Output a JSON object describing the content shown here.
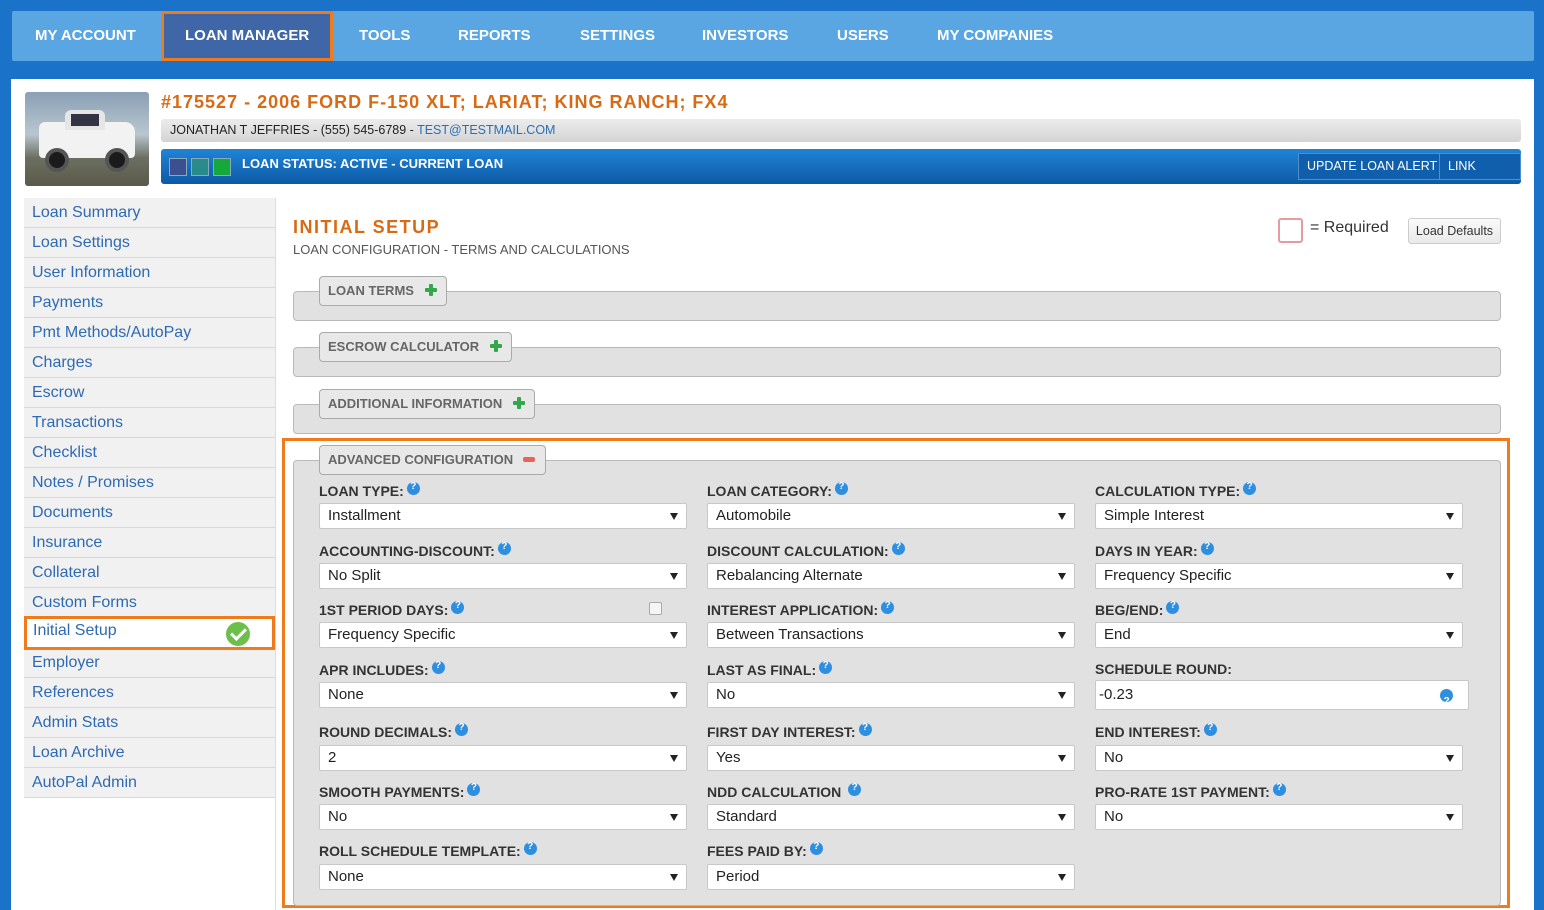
{
  "nav": {
    "items": [
      "MY ACCOUNT",
      "LOAN MANAGER",
      "TOOLS",
      "REPORTS",
      "SETTINGS",
      "INVESTORS",
      "USERS",
      "MY COMPANIES"
    ],
    "active_index": 1,
    "accent_color": "#ef7b1d"
  },
  "loan": {
    "title": "#175527 - 2006 FORD F-150 XLT; LARIAT; KING RANCH; FX4",
    "contact": "JONATHAN T JEFFRIES - (555) 545-6789 - ",
    "email": "TEST@TESTMAIL.COM",
    "status": "LOAN STATUS: ACTIVE - CURRENT LOAN",
    "status_colors": [
      "#3c4f8f",
      "#2a8c8a",
      "#15a83a"
    ],
    "buttons": {
      "alert": "UPDATE LOAN ALERT",
      "link": "LINK LOAN"
    }
  },
  "sidebar": {
    "items": [
      "Loan Summary",
      "Loan Settings",
      "User Information",
      "Payments",
      "Pmt Methods/AutoPay",
      "Charges",
      "Escrow",
      "Transactions",
      "Checklist",
      "Notes / Promises",
      "Documents",
      "Insurance",
      "Collateral",
      "Custom Forms",
      "Initial Setup",
      "Employer",
      "References",
      "Admin Stats",
      "Loan Archive",
      "AutoPal Admin"
    ],
    "active": "Initial Setup"
  },
  "page": {
    "title": "INITIAL SETUP",
    "subtitle": "LOAN CONFIGURATION - TERMS AND CALCULATIONS",
    "required_text": "= Required",
    "load_defaults": "Load Defaults"
  },
  "sections": {
    "loan_terms": "LOAN TERMS",
    "escrow": "ESCROW CALCULATOR",
    "additional": "ADDITIONAL INFORMATION",
    "advanced": "ADVANCED CONFIGURATION"
  },
  "fields": {
    "loan_type": {
      "label": "LOAN TYPE:",
      "value": "Installment"
    },
    "loan_category": {
      "label": "LOAN CATEGORY:",
      "value": "Automobile"
    },
    "calculation_type": {
      "label": "CALCULATION TYPE:",
      "value": "Simple Interest"
    },
    "accounting_discount": {
      "label": "ACCOUNTING-DISCOUNT:",
      "value": "No Split"
    },
    "discount_calculation": {
      "label": "DISCOUNT CALCULATION:",
      "value": "Rebalancing Alternate"
    },
    "days_in_year": {
      "label": "DAYS IN YEAR:",
      "value": "Frequency Specific"
    },
    "first_period_days": {
      "label": "1ST PERIOD DAYS:",
      "value": "Frequency Specific"
    },
    "interest_application": {
      "label": "INTEREST APPLICATION:",
      "value": "Between Transactions"
    },
    "beg_end": {
      "label": "BEG/END:",
      "value": "End"
    },
    "apr_includes": {
      "label": "APR INCLUDES:",
      "value": "None"
    },
    "last_as_final": {
      "label": "LAST AS FINAL:",
      "value": "No"
    },
    "schedule_round": {
      "label": "SCHEDULE ROUND:",
      "value": "-0.23"
    },
    "round_decimals": {
      "label": "ROUND DECIMALS:",
      "value": "2"
    },
    "first_day_interest": {
      "label": "FIRST DAY INTEREST:",
      "value": "Yes"
    },
    "end_interest": {
      "label": "END INTEREST:",
      "value": "No"
    },
    "smooth_payments": {
      "label": "SMOOTH PAYMENTS:",
      "value": "No"
    },
    "ndd_calculation": {
      "label": "NDD CALCULATION",
      "value": "Standard"
    },
    "prorate_first_payment": {
      "label": "PRO-RATE 1ST PAYMENT:",
      "value": "No"
    },
    "roll_schedule_template": {
      "label": "ROLL SCHEDULE TEMPLATE:",
      "value": "None"
    },
    "fees_paid_by": {
      "label": "FEES PAID BY:",
      "value": "Period"
    }
  }
}
